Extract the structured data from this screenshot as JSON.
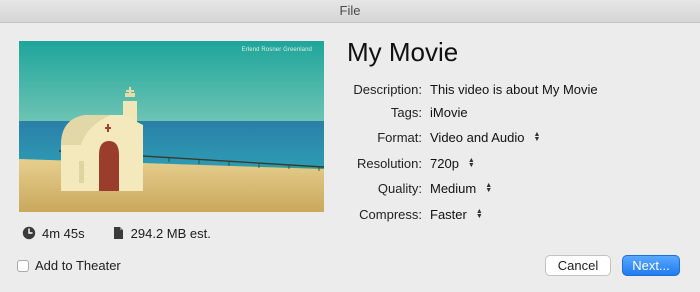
{
  "window": {
    "title": "File"
  },
  "preview": {
    "watermark": "Erlend Rosner Greenland"
  },
  "meta": {
    "duration": "4m 45s",
    "size": "294.2 MB est."
  },
  "movie_title": "My Movie",
  "fields": {
    "description": {
      "label": "Description:",
      "value": "This video is about My Movie"
    },
    "tags": {
      "label": "Tags:",
      "value": "iMovie"
    },
    "format": {
      "label": "Format:",
      "value": "Video and Audio"
    },
    "resolution": {
      "label": "Resolution:",
      "value": "720p"
    },
    "quality": {
      "label": "Quality:",
      "value": "Medium"
    },
    "compress": {
      "label": "Compress:",
      "value": "Faster"
    }
  },
  "theater": {
    "label": "Add to Theater",
    "checked": false
  },
  "buttons": {
    "cancel": "Cancel",
    "next": "Next..."
  },
  "colors": {
    "accent": "#1f7cf1",
    "window_bg": "#ececec"
  },
  "icons": {
    "duration": "clock-icon",
    "size": "document-icon"
  }
}
